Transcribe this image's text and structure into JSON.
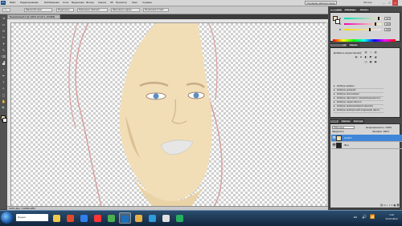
{
  "app": {
    "logo": "Ps"
  },
  "menubar": {
    "items": [
      "Файл",
      "Редактирование",
      "Изображение",
      "Слои",
      "Выделение",
      "Фильтр",
      "Анализ",
      "3D",
      "Просмотр",
      "Окно",
      "Справка"
    ],
    "workspace": "Основная рабочая среда",
    "live": "CS Live"
  },
  "options_bar": {
    "buttons": [
      "Масштаб окон",
      "Подогнать",
      "Реальные пиксели",
      "Заполнить экран",
      "Печатный оттиск"
    ]
  },
  "document": {
    "tab_title": "Безымянный-1 @ 100% (Слой 1, RGB/8)",
    "status": "100%   Док: 1,34M/6,28M"
  },
  "tools": [
    "⇲",
    "▭",
    "ʘ",
    "✂",
    "✦",
    "✎",
    "⌫",
    "▟",
    "◐",
    "✒",
    "T",
    "↖",
    "▢",
    "✋",
    "🔍"
  ],
  "panels": {
    "top_tabs": [
      "Цвет",
      "Образцы",
      "Стили"
    ],
    "color": {
      "colors": {
        "fg": "#f1deb6",
        "bg": "#ffffff"
      },
      "sliders": [
        {
          "label": "R",
          "value": "241",
          "pos": 0.95
        },
        {
          "label": "G",
          "value": "222",
          "pos": 0.87
        },
        {
          "label": "B",
          "value": "182",
          "pos": 0.71
        }
      ]
    },
    "adjust_tabs": [
      "Коррекция",
      "Маски"
    ],
    "adjust": {
      "title": "Добавить корректировку",
      "icons": [
        "☼",
        "▥",
        "◑",
        "▨",
        "▤",
        "⊟",
        "◧",
        "◩",
        "◪",
        "◫",
        "▦",
        "▣"
      ],
      "presets": [
        "Наборы кривых",
        "Наборы уровней",
        "Наборы экспозиции",
        "Наборы цветового тона/насыщенности",
        "Наборы черно-белого",
        "Наборы микширования каналов",
        "Наборы выборочной коррекции цвета"
      ]
    },
    "layer_tabs": [
      "Слои",
      "Каналы",
      "Контуры"
    ],
    "layers": {
      "mode": "Обычные",
      "opacity": "Непрозрачность: 100%",
      "lock": "Закрепить:",
      "fill": "Заливка: 100%",
      "rows": [
        {
          "name": "Слой 1",
          "selected": true
        },
        {
          "name": "Фон",
          "selected": false
        }
      ]
    }
  },
  "taskbar": {
    "items": [
      {
        "name": "explorer",
        "color": "#f2c94c"
      },
      {
        "name": "browser",
        "color": "#e04a2a"
      },
      {
        "name": "media",
        "color": "#2f80ed"
      },
      {
        "name": "yandex",
        "color": "#ff3333"
      },
      {
        "name": "chrome",
        "color": "#4caf50"
      },
      {
        "name": "photoshop",
        "color": "#1b6fb8"
      },
      {
        "name": "folder",
        "color": "#e8b04a"
      },
      {
        "name": "player",
        "color": "#2d9cdb"
      },
      {
        "name": "yandex-2",
        "color": "#e0e0e0"
      },
      {
        "name": "app",
        "color": "#27ae60"
      }
    ],
    "search_text": "Яндекс",
    "lang": "EN",
    "time": "1:12",
    "date": "23.03.2013"
  }
}
